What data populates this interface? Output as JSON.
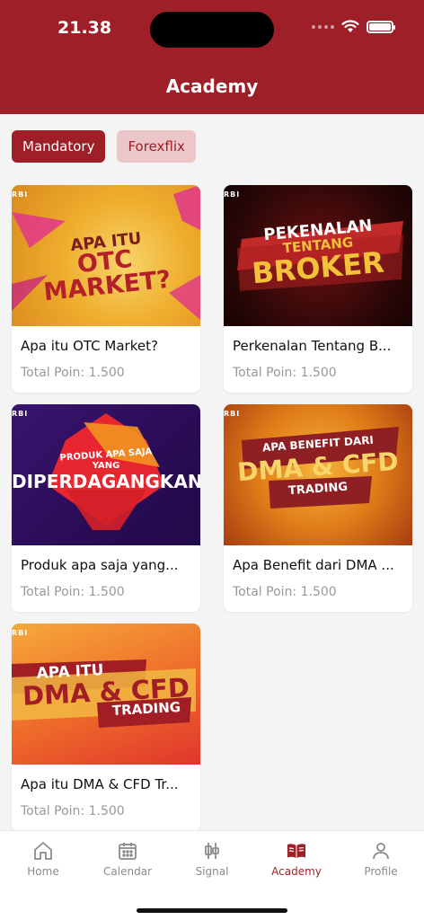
{
  "status_bar": {
    "time": "21.38"
  },
  "header": {
    "title": "Academy"
  },
  "tabs": [
    {
      "label": "Mandatory",
      "active": true
    },
    {
      "label": "Forexflix",
      "active": false
    }
  ],
  "logo_text": "RBI",
  "courses": [
    {
      "title": "Apa itu OTC Market?",
      "points": "Total Poin: 1.500",
      "thumb_lines": [
        "APA ITU",
        "OTC MARKET?"
      ]
    },
    {
      "title": "Perkenalan Tentang B...",
      "points": "Total Poin: 1.500",
      "thumb_lines": [
        "PEKENALAN",
        "TENTANG",
        "BROKER"
      ]
    },
    {
      "title": "Produk apa saja yang...",
      "points": "Total Poin: 1.500",
      "thumb_lines": [
        "PRODUK APA SAJA",
        "YANG",
        "DIPERDAGANGKAN"
      ]
    },
    {
      "title": "Apa Benefit dari DMA ...",
      "points": "Total Poin: 1.500",
      "thumb_lines": [
        "APA BENEFIT DARI",
        "DMA & CFD",
        "TRADING"
      ]
    },
    {
      "title": "Apa itu DMA & CFD Tr...",
      "points": "Total Poin: 1.500",
      "thumb_lines": [
        "APA ITU",
        "DMA & CFD",
        "TRADING"
      ]
    }
  ],
  "nav": {
    "items": [
      {
        "label": "Home",
        "icon": "home-icon"
      },
      {
        "label": "Calendar",
        "icon": "calendar-icon"
      },
      {
        "label": "Signal",
        "icon": "signal-icon"
      },
      {
        "label": "Academy",
        "icon": "book-icon",
        "active": true
      },
      {
        "label": "Profile",
        "icon": "profile-icon"
      }
    ]
  },
  "colors": {
    "brand": "#9e1f27",
    "tab_inactive_bg": "#ecc7c9",
    "muted_text": "#999999"
  }
}
